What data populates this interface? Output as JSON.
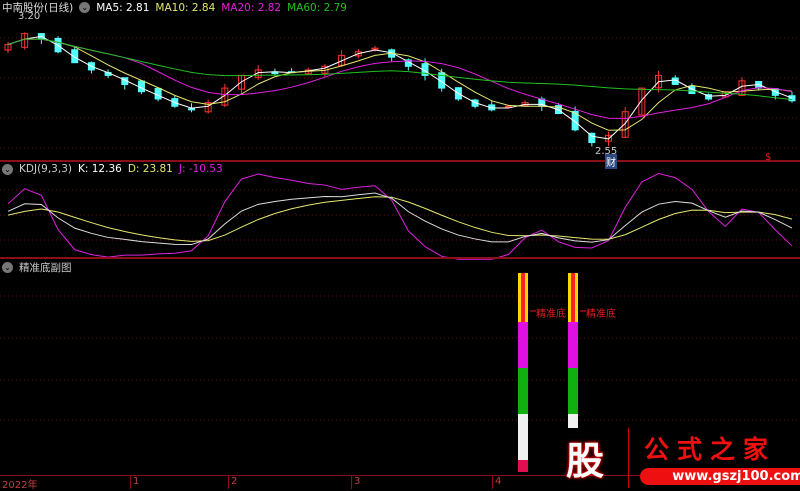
{
  "main": {
    "title": "中南股份(日线)",
    "ma5": "MA5: 2.81",
    "ma10": "MA10: 2.84",
    "ma20": "MA20: 2.82",
    "ma60": "MA60: 2.79",
    "high_label": "3.20",
    "low_label": "2.55",
    "badge_cai": "财",
    "badge_s": "$"
  },
  "kdj": {
    "title": "KDJ(9,3,3)",
    "k": "K: 12.36",
    "d": "D: 23.81",
    "j": "J: -10.53"
  },
  "sub": {
    "title": "精准底副图",
    "signal_label": "精准底"
  },
  "axis": {
    "labels": [
      "2022年",
      "1",
      "2",
      "3",
      "4"
    ]
  },
  "logo": {
    "char": "股",
    "name": "公式之家",
    "url": "www.gszj100.com"
  },
  "colors": {
    "up": "#ff3232",
    "down": "#54ffff",
    "ma5": "#ffffff",
    "ma10": "#e6e66e",
    "ma20": "#e020e0",
    "ma60": "#20c020",
    "grid": "#6a1010"
  },
  "chart_data": {
    "type": "candlestick",
    "price_range": [
      2.55,
      3.2
    ],
    "closes": [
      3.12,
      3.18,
      3.15,
      3.08,
      3.02,
      2.98,
      2.95,
      2.9,
      2.86,
      2.82,
      2.78,
      2.76,
      2.8,
      2.88,
      2.95,
      2.98,
      2.96,
      2.97,
      2.98,
      3.0,
      3.06,
      3.08,
      3.1,
      3.05,
      3.0,
      2.95,
      2.88,
      2.82,
      2.78,
      2.76,
      2.78,
      2.8,
      2.78,
      2.74,
      2.65,
      2.58,
      2.62,
      2.75,
      2.88,
      2.95,
      2.9,
      2.85,
      2.82,
      2.86,
      2.92,
      2.88,
      2.84,
      2.81
    ],
    "signal_bars_index": [
      31,
      34
    ]
  }
}
